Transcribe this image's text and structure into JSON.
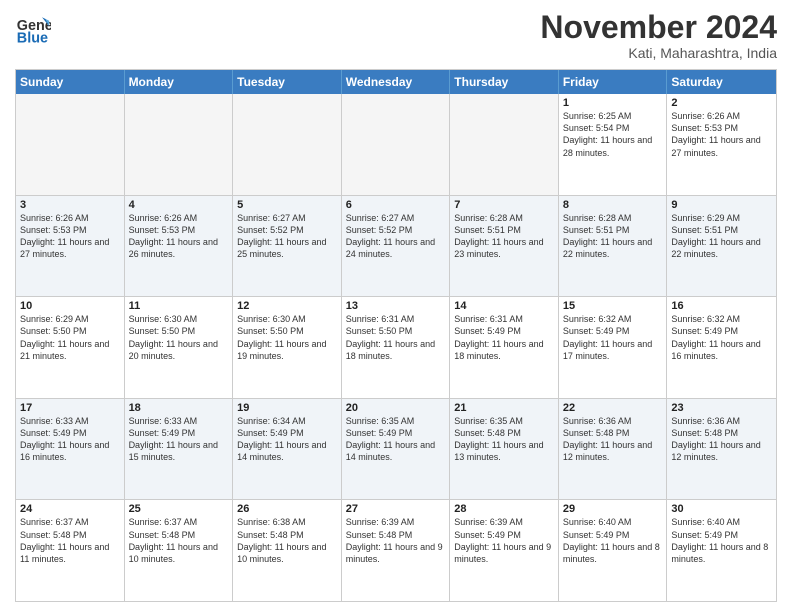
{
  "header": {
    "logo_line1": "General",
    "logo_line2": "Blue",
    "month_title": "November 2024",
    "subtitle": "Kati, Maharashtra, India"
  },
  "weekdays": [
    "Sunday",
    "Monday",
    "Tuesday",
    "Wednesday",
    "Thursday",
    "Friday",
    "Saturday"
  ],
  "rows": [
    [
      {
        "day": "",
        "empty": true
      },
      {
        "day": "",
        "empty": true
      },
      {
        "day": "",
        "empty": true
      },
      {
        "day": "",
        "empty": true
      },
      {
        "day": "",
        "empty": true
      },
      {
        "day": "1",
        "sunrise": "6:25 AM",
        "sunset": "5:54 PM",
        "daylight": "11 hours and 28 minutes."
      },
      {
        "day": "2",
        "sunrise": "6:26 AM",
        "sunset": "5:53 PM",
        "daylight": "11 hours and 27 minutes."
      }
    ],
    [
      {
        "day": "3",
        "sunrise": "6:26 AM",
        "sunset": "5:53 PM",
        "daylight": "11 hours and 27 minutes."
      },
      {
        "day": "4",
        "sunrise": "6:26 AM",
        "sunset": "5:53 PM",
        "daylight": "11 hours and 26 minutes."
      },
      {
        "day": "5",
        "sunrise": "6:27 AM",
        "sunset": "5:52 PM",
        "daylight": "11 hours and 25 minutes."
      },
      {
        "day": "6",
        "sunrise": "6:27 AM",
        "sunset": "5:52 PM",
        "daylight": "11 hours and 24 minutes."
      },
      {
        "day": "7",
        "sunrise": "6:28 AM",
        "sunset": "5:51 PM",
        "daylight": "11 hours and 23 minutes."
      },
      {
        "day": "8",
        "sunrise": "6:28 AM",
        "sunset": "5:51 PM",
        "daylight": "11 hours and 22 minutes."
      },
      {
        "day": "9",
        "sunrise": "6:29 AM",
        "sunset": "5:51 PM",
        "daylight": "11 hours and 22 minutes."
      }
    ],
    [
      {
        "day": "10",
        "sunrise": "6:29 AM",
        "sunset": "5:50 PM",
        "daylight": "11 hours and 21 minutes."
      },
      {
        "day": "11",
        "sunrise": "6:30 AM",
        "sunset": "5:50 PM",
        "daylight": "11 hours and 20 minutes."
      },
      {
        "day": "12",
        "sunrise": "6:30 AM",
        "sunset": "5:50 PM",
        "daylight": "11 hours and 19 minutes."
      },
      {
        "day": "13",
        "sunrise": "6:31 AM",
        "sunset": "5:50 PM",
        "daylight": "11 hours and 18 minutes."
      },
      {
        "day": "14",
        "sunrise": "6:31 AM",
        "sunset": "5:49 PM",
        "daylight": "11 hours and 18 minutes."
      },
      {
        "day": "15",
        "sunrise": "6:32 AM",
        "sunset": "5:49 PM",
        "daylight": "11 hours and 17 minutes."
      },
      {
        "day": "16",
        "sunrise": "6:32 AM",
        "sunset": "5:49 PM",
        "daylight": "11 hours and 16 minutes."
      }
    ],
    [
      {
        "day": "17",
        "sunrise": "6:33 AM",
        "sunset": "5:49 PM",
        "daylight": "11 hours and 16 minutes."
      },
      {
        "day": "18",
        "sunrise": "6:33 AM",
        "sunset": "5:49 PM",
        "daylight": "11 hours and 15 minutes."
      },
      {
        "day": "19",
        "sunrise": "6:34 AM",
        "sunset": "5:49 PM",
        "daylight": "11 hours and 14 minutes."
      },
      {
        "day": "20",
        "sunrise": "6:35 AM",
        "sunset": "5:49 PM",
        "daylight": "11 hours and 14 minutes."
      },
      {
        "day": "21",
        "sunrise": "6:35 AM",
        "sunset": "5:48 PM",
        "daylight": "11 hours and 13 minutes."
      },
      {
        "day": "22",
        "sunrise": "6:36 AM",
        "sunset": "5:48 PM",
        "daylight": "11 hours and 12 minutes."
      },
      {
        "day": "23",
        "sunrise": "6:36 AM",
        "sunset": "5:48 PM",
        "daylight": "11 hours and 12 minutes."
      }
    ],
    [
      {
        "day": "24",
        "sunrise": "6:37 AM",
        "sunset": "5:48 PM",
        "daylight": "11 hours and 11 minutes."
      },
      {
        "day": "25",
        "sunrise": "6:37 AM",
        "sunset": "5:48 PM",
        "daylight": "11 hours and 10 minutes."
      },
      {
        "day": "26",
        "sunrise": "6:38 AM",
        "sunset": "5:48 PM",
        "daylight": "11 hours and 10 minutes."
      },
      {
        "day": "27",
        "sunrise": "6:39 AM",
        "sunset": "5:48 PM",
        "daylight": "11 hours and 9 minutes."
      },
      {
        "day": "28",
        "sunrise": "6:39 AM",
        "sunset": "5:49 PM",
        "daylight": "11 hours and 9 minutes."
      },
      {
        "day": "29",
        "sunrise": "6:40 AM",
        "sunset": "5:49 PM",
        "daylight": "11 hours and 8 minutes."
      },
      {
        "day": "30",
        "sunrise": "6:40 AM",
        "sunset": "5:49 PM",
        "daylight": "11 hours and 8 minutes."
      }
    ]
  ],
  "labels": {
    "sunrise": "Sunrise:",
    "sunset": "Sunset:",
    "daylight": "Daylight:"
  }
}
